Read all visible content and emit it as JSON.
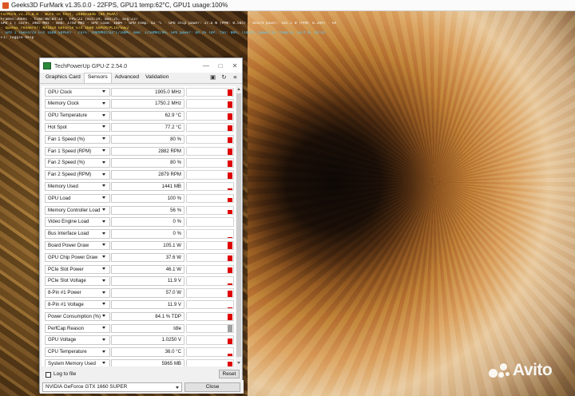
{
  "furmark": {
    "title": "Geeks3D FurMark v1.35.0.0 - 22FPS, GPU1 temp:62°C, GPU1 usage:100%",
    "osd": [
      {
        "text": "FurMark v1.35.0.0 - Burn-in test, 2480x1046 (8X MSAA)",
        "color": "yellow"
      },
      {
        "text": "Frames:36691 - time:00:04:33 - FPS:22 (min:19, max:25, avg:23)",
        "color": "white"
      },
      {
        "text": "GPU 1 [ core: 1905 MHz - mem: 1750 MHz - GPU load: 100% - GPU temp: 62 °C - GPU chip power: 37.6 W (PPW: 0.585) - Board power: 105.1 W (PPW: 0.209) - GPU voltage: 1.025 V",
        "color": "white"
      },
      {
        "text": "- OpenGL renderer: NVIDIA GeForce GTX 1660 SUPER/PCIe/SSE2",
        "color": "yellow"
      },
      {
        "text": "- GPU 1 (GeForce GTX 1660 SUPER) - core: 1905MHz/62°C/100%, mem: 1750MHz/8%, GPU power: 84.1% TDP, fan: 80%, limits:[power:0, temp:0, volt:0, OV:0]",
        "color": "cyan"
      },
      {
        "text": "F1: Toggle help",
        "color": "white"
      }
    ]
  },
  "gpuz": {
    "title": "TechPowerUp GPU-Z 2.54.0",
    "tabs": [
      "Graphics Card",
      "Sensors",
      "Advanced",
      "Validation"
    ],
    "active_tab": "Sensors",
    "sensors": [
      {
        "name": "GPU Clock",
        "value": "1905.0 MHz",
        "level": 0.8
      },
      {
        "name": "Memory Clock",
        "value": "1750.2 MHz",
        "level": 0.8
      },
      {
        "name": "GPU Temperature",
        "value": "62.9 °C",
        "level": 0.75
      },
      {
        "name": "Hot Spot",
        "value": "77.2 °C",
        "level": 0.78
      },
      {
        "name": "Fan 1 Speed (%)",
        "value": "80 %",
        "level": 0.8
      },
      {
        "name": "Fan 1 Speed (RPM)",
        "value": "2882 RPM",
        "level": 0.8
      },
      {
        "name": "Fan 2 Speed (%)",
        "value": "80 %",
        "level": 0.8
      },
      {
        "name": "Fan 2 Speed (RPM)",
        "value": "2879 RPM",
        "level": 0.8
      },
      {
        "name": "Memory Used",
        "value": "1441 MB",
        "level": 0.25
      },
      {
        "name": "GPU Load",
        "value": "100 %",
        "level": 0.6
      },
      {
        "name": "Memory Controller Load",
        "value": "56 %",
        "level": 0.55
      },
      {
        "name": "Video Engine Load",
        "value": "0 %",
        "level": 0
      },
      {
        "name": "Bus Interface Load",
        "value": "0 %",
        "level": 0.05
      },
      {
        "name": "Board Power Draw",
        "value": "105.1 W",
        "level": 1.0
      },
      {
        "name": "GPU Chip Power Draw",
        "value": "37.6 W",
        "level": 0.8
      },
      {
        "name": "PCIe Slot Power",
        "value": "46.1 W",
        "level": 0.75
      },
      {
        "name": "PCIe Slot Voltage",
        "value": "11.9 V",
        "level": 0.2
      },
      {
        "name": "8-Pin #1 Power",
        "value": "57.0 W",
        "level": 0.75
      },
      {
        "name": "8-Pin #1 Voltage",
        "value": "11.9 V",
        "level": 0.2
      },
      {
        "name": "Power Consumption (%)",
        "value": "84.1 % TDP",
        "level": 0.9
      },
      {
        "name": "PerfCap Reason",
        "value": "Idle",
        "level": 1.0,
        "gray": true
      },
      {
        "name": "GPU Voltage",
        "value": "1.0250 V",
        "level": 0.75
      },
      {
        "name": "CPU Temperature",
        "value": "36.0 °C",
        "level": 0.3
      },
      {
        "name": "System Memory Used",
        "value": "5965 MB",
        "level": 0.8
      }
    ],
    "log_label": "Log to file",
    "reset_label": "Reset",
    "gpu_selected": "NVIDIA GeForce GTX 1660 SUPER",
    "close_label": "Close",
    "bar_color": "#e00000",
    "bar_gray": "#a0a0a0"
  },
  "watermark": {
    "text": "Avito"
  }
}
